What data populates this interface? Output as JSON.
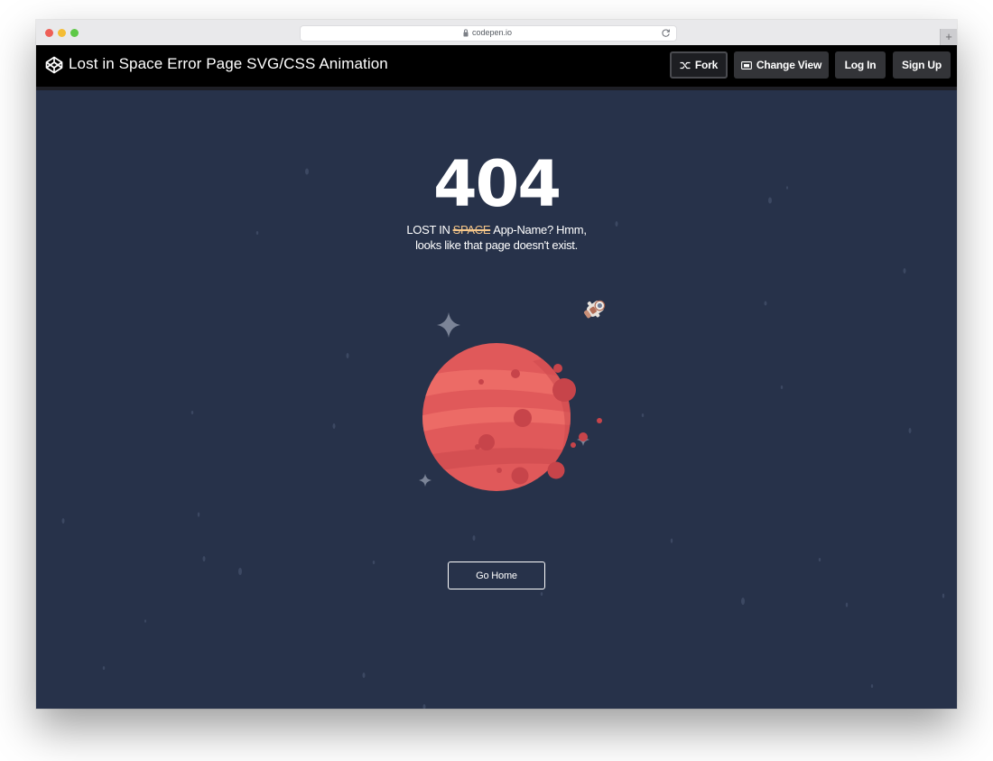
{
  "browser": {
    "url": "codepen.io",
    "newtab_label": "+"
  },
  "header": {
    "title": "Lost in Space Error Page SVG/CSS Animation",
    "buttons": {
      "fork": "Fork",
      "change_view": "Change View",
      "log_in": "Log In",
      "sign_up": "Sign Up"
    }
  },
  "page": {
    "error_code": "404",
    "message_prefix": "LOST IN",
    "message_strike": "SPACE",
    "message_rest": "App-Name? Hmm, looks like that page doesn't exist.",
    "go_home": "Go Home"
  },
  "colors": {
    "background": "#27324a",
    "planet": "#e0595a",
    "accent_strike": "#f5c689",
    "header": "#000000"
  },
  "icons": [
    "lock-icon",
    "reload-icon",
    "codepen-logo-icon",
    "fork-icon",
    "change-view-icon",
    "sparkle-icon",
    "astronaut-icon",
    "planet-icon"
  ]
}
